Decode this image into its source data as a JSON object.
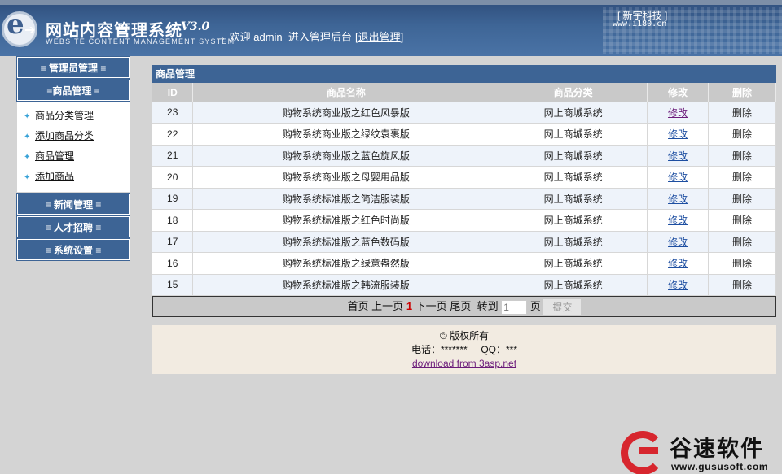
{
  "header": {
    "title": "网站内容管理系统",
    "version": "V3.0",
    "subtitle": "WEBSITE CONTENT MANAGEMENT SYSTEM",
    "arrow": "→",
    "welcome_prefix": "欢迎 admin",
    "enter_admin": "进入管理后台",
    "logout": "退出管理",
    "brand": "[  新宇科技  ]",
    "brand_url": "www.i180.cn"
  },
  "sidebar": {
    "groups": [
      {
        "label": "≡ 管理员管理 ≡"
      },
      {
        "label": "≡商品管理 ≡"
      },
      {
        "label": "≡ 新闻管理 ≡"
      },
      {
        "label": "≡ 人才招聘 ≡"
      },
      {
        "label": "≡ 系统设置 ≡"
      }
    ],
    "sub_items": [
      {
        "label": "商品分类管理"
      },
      {
        "label": "添加商品分类"
      },
      {
        "label": "商品管理"
      },
      {
        "label": "添加商品"
      }
    ]
  },
  "main": {
    "panel_title": "商品管理",
    "columns": [
      "ID",
      "商品名称",
      "商品分类",
      "修改",
      "删除"
    ],
    "rows": [
      {
        "id": "23",
        "name": "购物系统商业版之红色风暴版",
        "category": "网上商城系统",
        "edit": "修改",
        "delete": "删除"
      },
      {
        "id": "22",
        "name": "购物系统商业版之绿纹袁裹版",
        "category": "网上商城系统",
        "edit": "修改",
        "delete": "删除"
      },
      {
        "id": "21",
        "name": "购物系统商业版之蓝色旋风版",
        "category": "网上商城系统",
        "edit": "修改",
        "delete": "删除"
      },
      {
        "id": "20",
        "name": "购物系统商业版之母婴用品版",
        "category": "网上商城系统",
        "edit": "修改",
        "delete": "删除"
      },
      {
        "id": "19",
        "name": "购物系统标准版之简洁服装版",
        "category": "网上商城系统",
        "edit": "修改",
        "delete": "删除"
      },
      {
        "id": "18",
        "name": "购物系统标准版之红色时尚版",
        "category": "网上商城系统",
        "edit": "修改",
        "delete": "删除"
      },
      {
        "id": "17",
        "name": "购物系统标准版之蓝色数码版",
        "category": "网上商城系统",
        "edit": "修改",
        "delete": "删除"
      },
      {
        "id": "16",
        "name": "购物系统标准版之绿意盎然版",
        "category": "网上商城系统",
        "edit": "修改",
        "delete": "删除"
      },
      {
        "id": "15",
        "name": "购物系统标准版之韩流服装版",
        "category": "网上商城系统",
        "edit": "修改",
        "delete": "删除"
      }
    ],
    "pager": {
      "first": "首页",
      "prev": "上一页",
      "current": "1",
      "next": "下一页",
      "last": "尾页",
      "goto": "转到",
      "goto_placeholder": "1",
      "page_unit": "页",
      "submit": "提交"
    }
  },
  "footer": {
    "copyright": "© 版权所有",
    "contact": "电话：*******     QQ：***",
    "download": "download from 3asp.net"
  },
  "watermark": {
    "text": "谷速软件",
    "url": "www.gususoft.com"
  }
}
